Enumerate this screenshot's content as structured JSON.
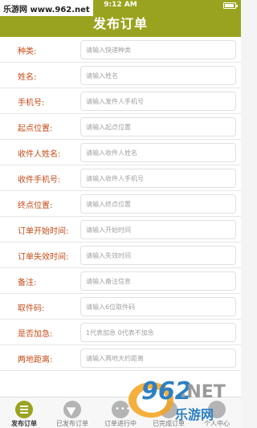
{
  "status": {
    "carrier": "乐游网 www.962.net",
    "time": "9:12 AM"
  },
  "header": {
    "title": "发布订单"
  },
  "form": {
    "fields": [
      {
        "label": "种类:",
        "placeholder": "请输入快递种类"
      },
      {
        "label": "姓名:",
        "placeholder": "请输入姓名"
      },
      {
        "label": "手机号:",
        "placeholder": "请输入发件人手机号"
      },
      {
        "label": "起点位置:",
        "placeholder": "请输入起点位置"
      },
      {
        "label": "收件人姓名:",
        "placeholder": "请输入收件人姓名"
      },
      {
        "label": "收件手机号:",
        "placeholder": "请输入收件人手机号"
      },
      {
        "label": "终点位置:",
        "placeholder": "请输入终点位置"
      },
      {
        "label": "订单开始时间:",
        "placeholder": "请输入开始时间"
      },
      {
        "label": "订单失效时间:",
        "placeholder": "请输入失效时间"
      },
      {
        "label": "备注:",
        "placeholder": "请输入备注信息"
      },
      {
        "label": "取件码:",
        "placeholder": "请输入6位取件码"
      },
      {
        "label": "是否加急:",
        "placeholder": "1代表加急 0代表不加急"
      },
      {
        "label": "两地距离:",
        "placeholder": "请输入两地大约距离"
      }
    ]
  },
  "tabbar": {
    "tabs": [
      {
        "label": "发布订单",
        "icon": "menu-icon",
        "active": true
      },
      {
        "label": "已发布订单",
        "icon": "paper-plane-icon",
        "active": false
      },
      {
        "label": "订单进行中",
        "icon": "more-icon",
        "active": false
      },
      {
        "label": "已完成订单",
        "icon": "check-icon",
        "active": false
      },
      {
        "label": "个人中心",
        "icon": "user-icon",
        "active": false
      }
    ]
  },
  "watermark": {
    "num": "962",
    "net": ".NET",
    "cn": "乐游网"
  },
  "colors": {
    "accent": "#9aa31f",
    "label": "#c84a16"
  }
}
